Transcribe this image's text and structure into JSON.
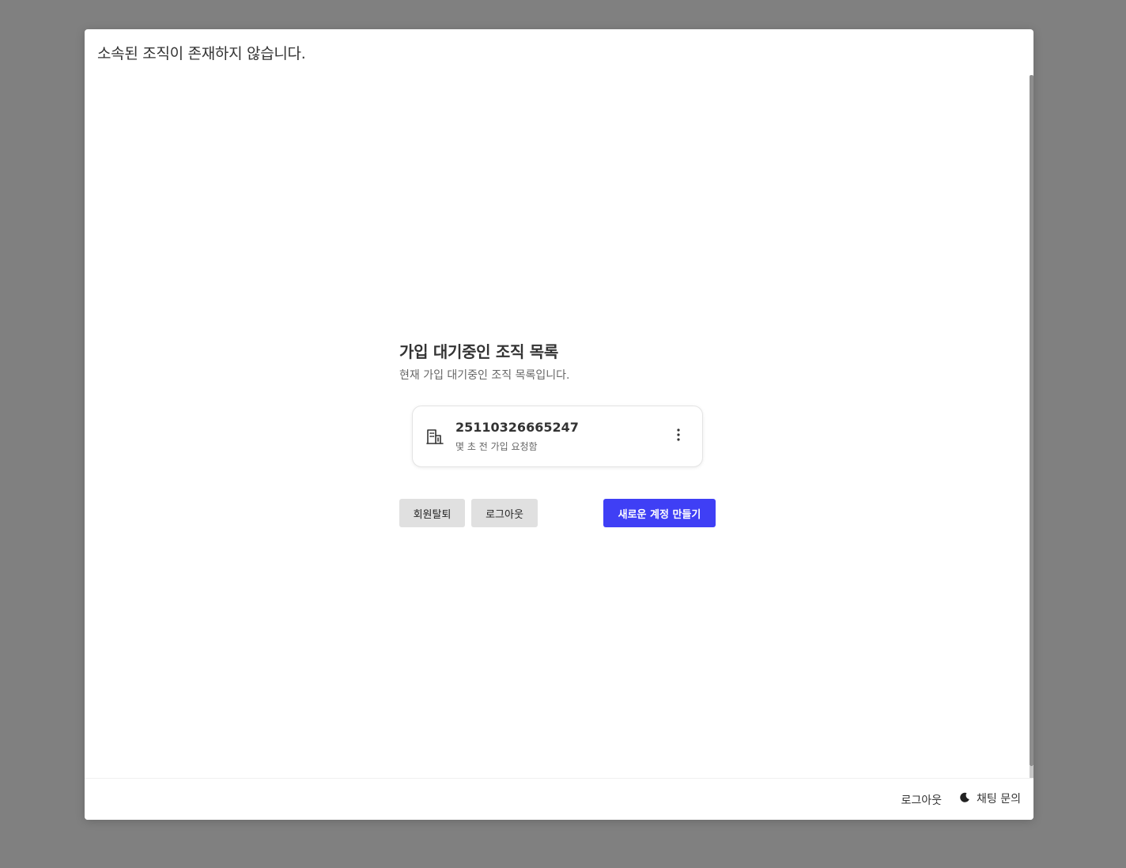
{
  "modal": {
    "header_title": "소속된 조직이 존재하지 않습니다."
  },
  "pending": {
    "title": "가입 대기중인 조직 목록",
    "subtitle": "현재 가입 대기중인 조직 목록입니다.",
    "items": [
      {
        "name": "25110326665247",
        "status": "몇 초 전 가입 요청함",
        "icon": "building-icon"
      }
    ]
  },
  "actions": {
    "withdraw_label": "회원탈퇴",
    "logout_label": "로그아웃",
    "create_account_label": "새로운 계정 만들기"
  },
  "footer": {
    "logout_label": "로그아웃",
    "chat_label": "채팅 문의",
    "chat_icon": "moon-icon"
  },
  "colors": {
    "primary": "#3f3ff5",
    "overlay": "#808080",
    "button_gray": "#e0e0e0"
  }
}
